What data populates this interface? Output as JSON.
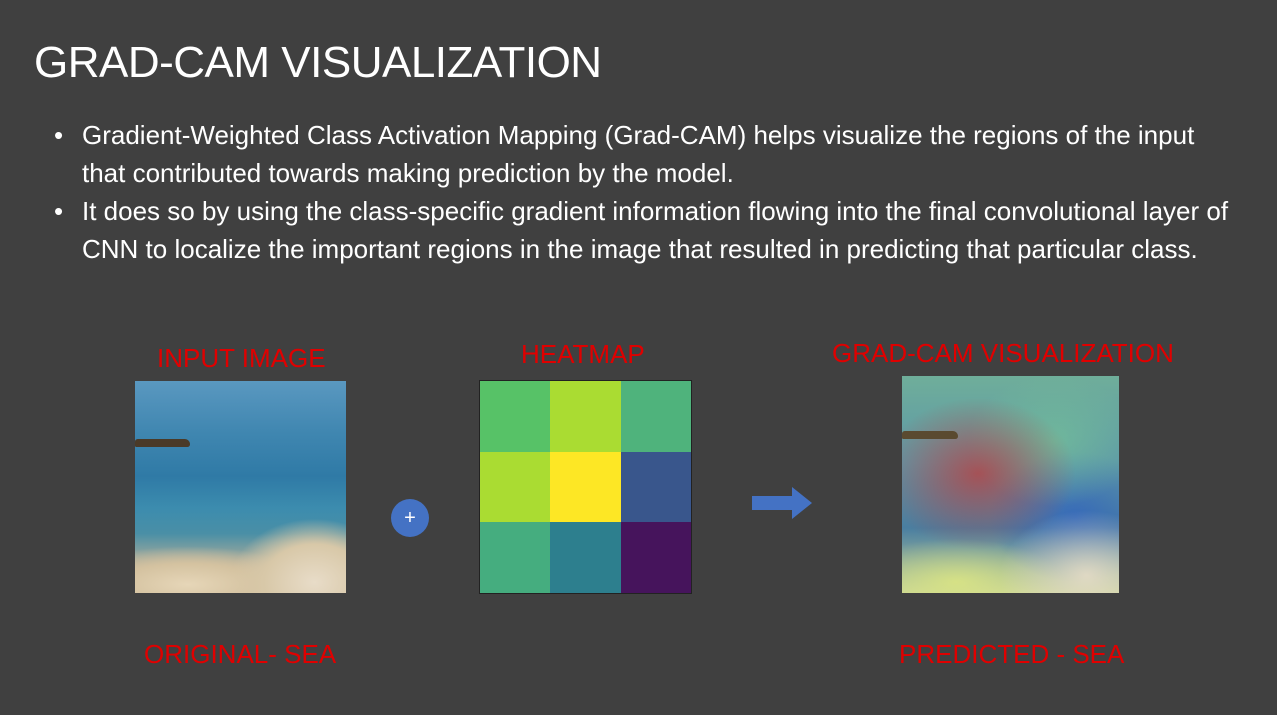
{
  "slide": {
    "title": "GRAD-CAM VISUALIZATION",
    "bullets": [
      "Gradient-Weighted Class Activation Mapping (Grad-CAM) helps visualize the regions of the input that contributed towards making prediction by the model.",
      "It does so by using the class-specific gradient information flowing into the final convolutional layer of CNN to localize the important regions in the image that resulted in predicting that particular class."
    ],
    "bullet_glyph": "•"
  },
  "figure": {
    "input_label": "INPUT IMAGE",
    "heatmap_label": "HEATMAP",
    "output_label": "GRAD-CAM VISUALIZATION",
    "original_caption": "ORIGINAL- SEA",
    "predicted_caption": "PREDICTED - SEA",
    "plus_symbol": "+",
    "plus_icon": "plus-circle-icon",
    "arrow_icon": "right-arrow-icon",
    "heatmap_cells": [
      "#57c267",
      "#aadc32",
      "#4fb37c",
      "#aadc32",
      "#fde725",
      "#39568c",
      "#45ad7f",
      "#2d7f8e",
      "#46145c"
    ]
  },
  "colors": {
    "background": "#404040",
    "text": "#ffffff",
    "label": "#e00000",
    "accent": "#4472c4"
  }
}
